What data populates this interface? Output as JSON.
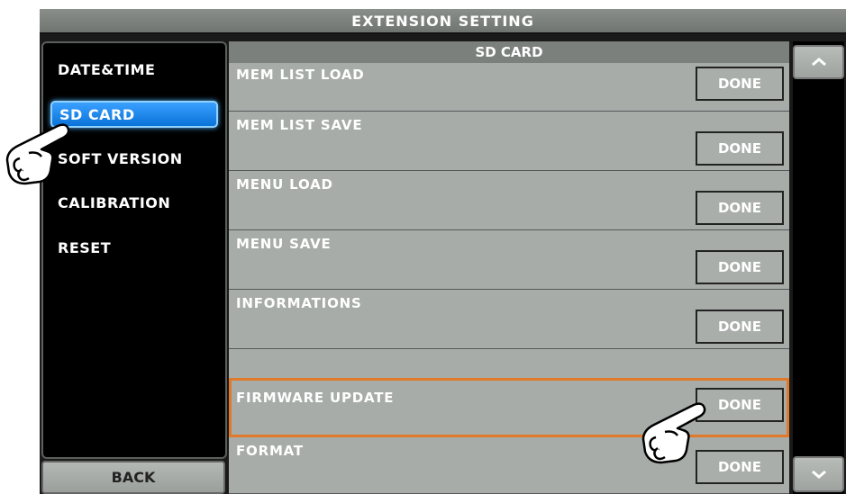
{
  "window": {
    "title": "EXTENSION SETTING"
  },
  "sidebar": {
    "items": [
      {
        "label": "DATE&TIME",
        "active": false
      },
      {
        "label": "SD CARD",
        "active": true
      },
      {
        "label": "SOFT VERSION",
        "active": false
      },
      {
        "label": "CALIBRATION",
        "active": false
      },
      {
        "label": "RESET",
        "active": false
      }
    ],
    "back_label": "BACK"
  },
  "panel": {
    "header": "SD CARD",
    "rows": [
      {
        "label": "MEM LIST LOAD",
        "button": "DONE"
      },
      {
        "label": "MEM LIST SAVE",
        "button": "DONE"
      },
      {
        "label": "MENU LOAD",
        "button": "DONE"
      },
      {
        "label": "MENU SAVE",
        "button": "DONE"
      },
      {
        "label": "INFORMATIONS",
        "button": "DONE"
      },
      {
        "label": "FIRMWARE UPDATE",
        "button": "DONE",
        "highlighted": true
      },
      {
        "label": "FORMAT",
        "button": "DONE"
      }
    ]
  },
  "scroll": {
    "up_icon": "chevron-up-icon",
    "down_icon": "chevron-down-icon"
  },
  "colors": {
    "active_item": "#1a86f0",
    "highlight_outline": "#e07a2a",
    "panel_bg": "#a7aca9"
  },
  "pointers": {
    "icon": "pointing-hand-icon"
  }
}
